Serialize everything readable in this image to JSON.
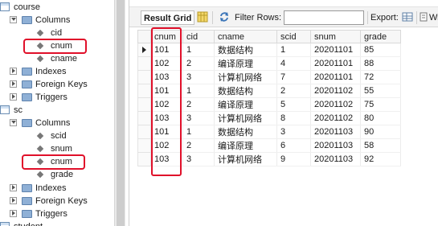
{
  "tree": {
    "course": {
      "label": "course",
      "columns_label": "Columns",
      "columns": [
        "cid",
        "cnum",
        "cname"
      ],
      "indexes_label": "Indexes",
      "fks_label": "Foreign Keys",
      "triggers_label": "Triggers"
    },
    "sc": {
      "label": "sc",
      "columns_label": "Columns",
      "columns": [
        "scid",
        "snum",
        "cnum",
        "grade"
      ],
      "indexes_label": "Indexes",
      "fks_label": "Foreign Keys",
      "triggers_label": "Triggers"
    },
    "student": {
      "label": "student"
    }
  },
  "toolbar": {
    "result_grid": "Result Grid",
    "filter_label": "Filter Rows:",
    "filter_value": "",
    "export_label": "Export:",
    "wrap_label": "Wr"
  },
  "grid": {
    "columns": [
      "cnum",
      "cid",
      "cname",
      "scid",
      "snum",
      "grade"
    ],
    "rows": [
      [
        "101",
        "1",
        "数据结构",
        "1",
        "20201101",
        "85"
      ],
      [
        "102",
        "2",
        "编译原理",
        "4",
        "20201101",
        "88"
      ],
      [
        "103",
        "3",
        "计算机网络",
        "7",
        "20201101",
        "72"
      ],
      [
        "101",
        "1",
        "数据结构",
        "2",
        "20201102",
        "55"
      ],
      [
        "102",
        "2",
        "编译原理",
        "5",
        "20201102",
        "75"
      ],
      [
        "103",
        "3",
        "计算机网络",
        "8",
        "20201102",
        "80"
      ],
      [
        "101",
        "1",
        "数据结构",
        "3",
        "20201103",
        "90"
      ],
      [
        "102",
        "2",
        "编译原理",
        "6",
        "20201103",
        "58"
      ],
      [
        "103",
        "3",
        "计算机网络",
        "9",
        "20201103",
        "92"
      ]
    ],
    "current_row": 0
  },
  "colors": {
    "highlight": "#e0102a"
  }
}
